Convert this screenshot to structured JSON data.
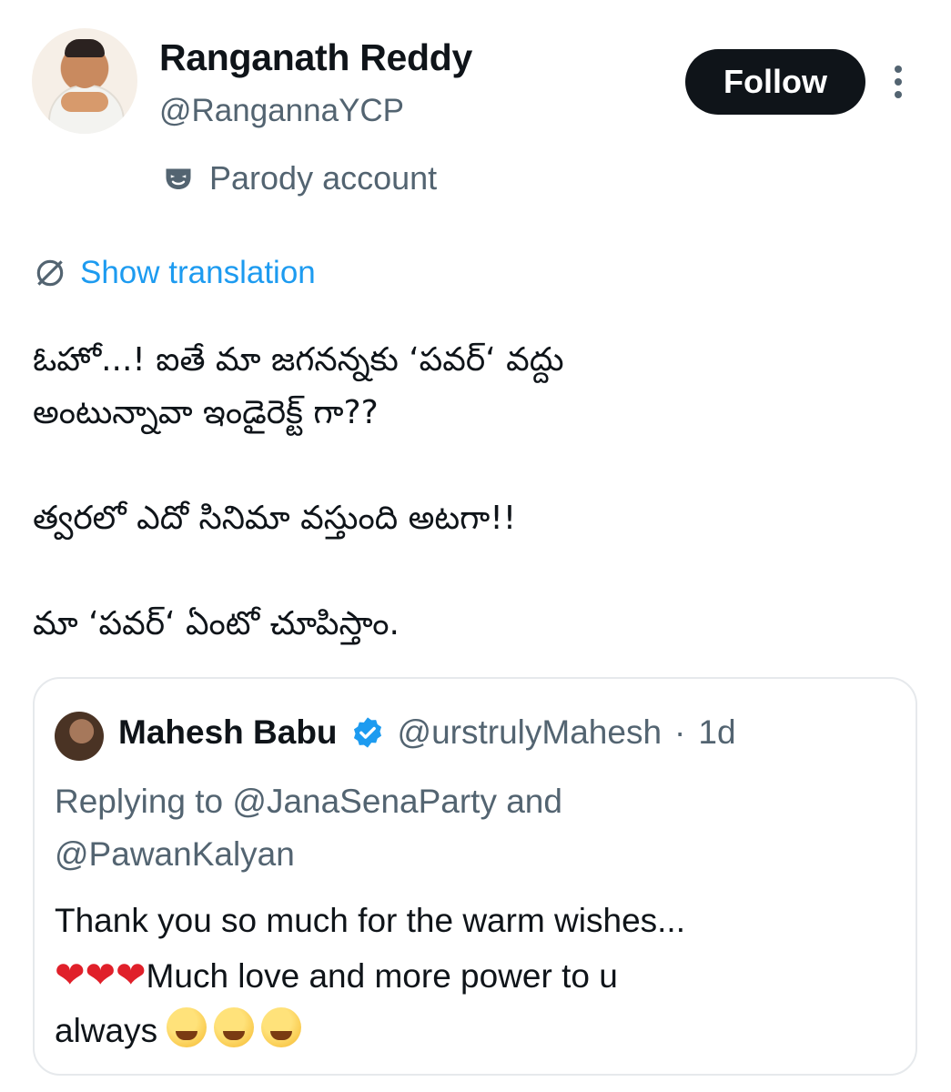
{
  "author": {
    "name": "Ranganath Reddy",
    "handle": "@RangannaYCP",
    "label": "Parody account"
  },
  "actions": {
    "follow_label": "Follow",
    "more_icon": "more-vertical-icon"
  },
  "translation": {
    "label": "Show translation",
    "icon": "globe-icon"
  },
  "tweet": {
    "line1": "ఓహో...! ఐతే మా జగనన్నకు ‘పవర్‘ వద్దు",
    "line2": "అంటున్నావా ఇండైరెక్ట్ గా??",
    "line3": "త్వరలో ఎదో సినిమా వస్తుంది అటగా!!",
    "line4": "మా ‘పవర్‘ ఏంటో చూపిస్తాం."
  },
  "quoted": {
    "name": "Mahesh Babu",
    "handle": "@urstrulyMahesh",
    "separator": "·",
    "time": "1d",
    "reply_line1": "Replying to @JanaSenaParty and",
    "reply_line2": "@PawanKalyan",
    "text_line1": "Thank you so much for the warm wishes...",
    "hearts": "❤❤❤",
    "text_line2": "Much love and more power to u",
    "text_line3": "always",
    "verified_color": "#1d9bf0"
  },
  "colors": {
    "accent": "#1d9bf0",
    "text": "#0f1419",
    "muted": "#536471"
  }
}
